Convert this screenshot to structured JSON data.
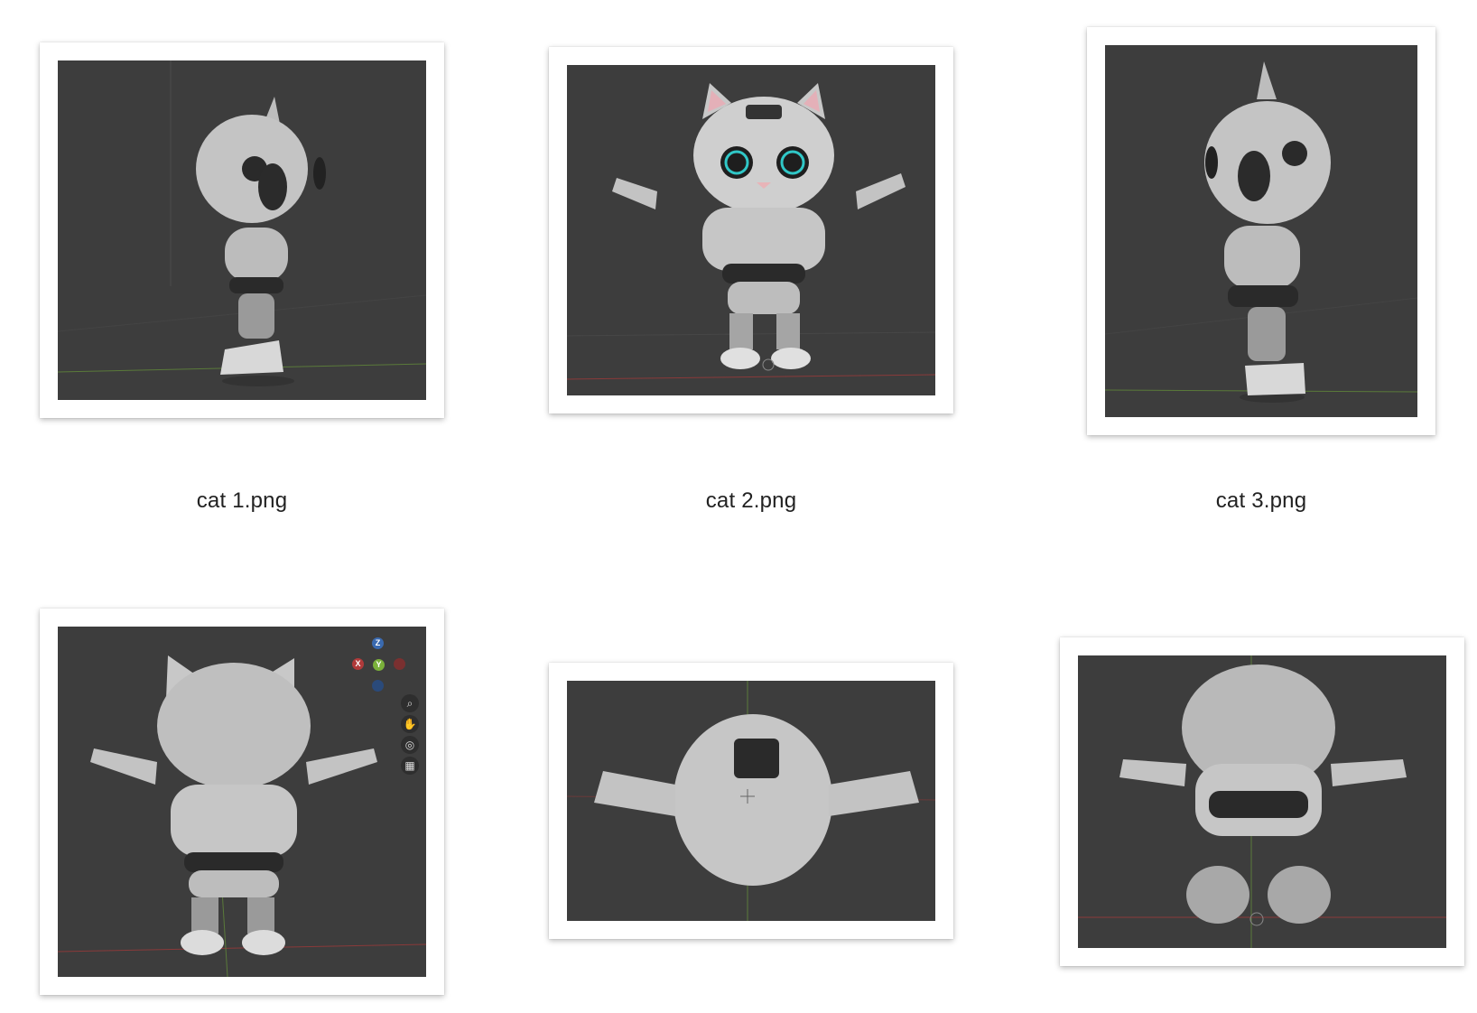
{
  "files": [
    {
      "name": "cat 1.png",
      "view": "side-left",
      "icon": "image-thumbnail-icon"
    },
    {
      "name": "cat 2.png",
      "view": "front",
      "icon": "image-thumbnail-icon"
    },
    {
      "name": "cat 3.png",
      "view": "side-right",
      "icon": "image-thumbnail-icon"
    },
    {
      "name": "",
      "view": "back",
      "icon": "image-thumbnail-icon"
    },
    {
      "name": "",
      "view": "top",
      "icon": "image-thumbnail-icon"
    },
    {
      "name": "",
      "view": "bottom",
      "icon": "image-thumbnail-icon"
    }
  ],
  "gizmo": {
    "z": "Z",
    "x": "X",
    "y": "Y"
  },
  "colors": {
    "viewport_bg": "#3d3d3d",
    "axis_red": "#b03a3a",
    "axis_green": "#6a8a3a",
    "axis_blue": "#3a6ab0"
  }
}
